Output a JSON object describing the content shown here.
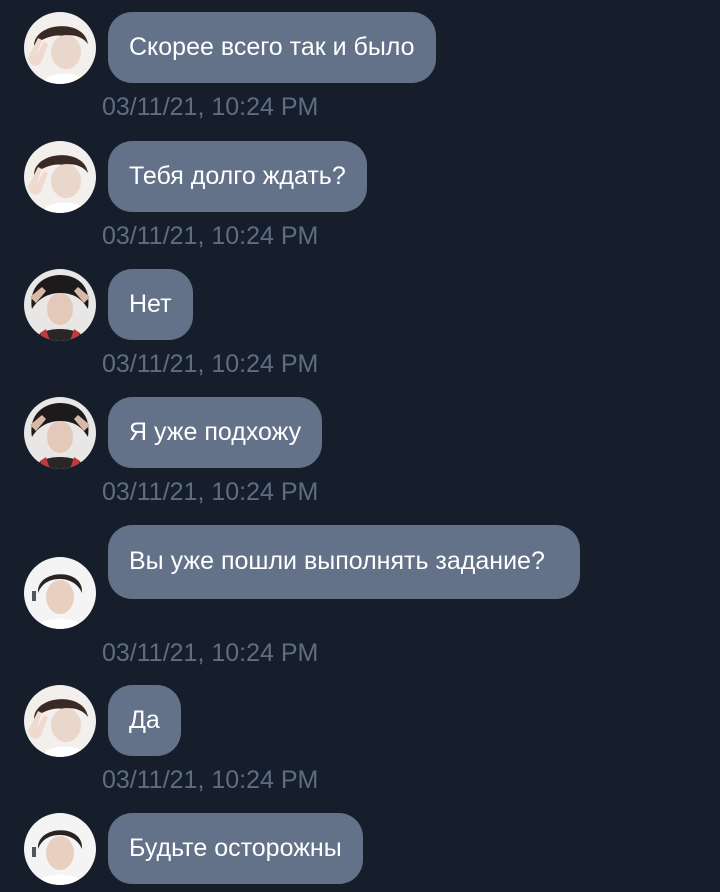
{
  "messages": [
    {
      "avatar": "avatar-hand-sign",
      "text": "Скорее всего так и было",
      "time": "03/11/21, 10:24 PM"
    },
    {
      "avatar": "avatar-hand-sign",
      "text": "Тебя долго ждать?",
      "time": "03/11/21, 10:24 PM"
    },
    {
      "avatar": "avatar-hands-on-head",
      "text": "Нет",
      "time": "03/11/21, 10:24 PM"
    },
    {
      "avatar": "avatar-hands-on-head",
      "text": "Я уже подхожу",
      "time": "03/11/21, 10:24 PM"
    },
    {
      "avatar": "avatar-portrait",
      "text": "Вы уже пошли выполнять задание?",
      "time": "03/11/21, 10:24 PM"
    },
    {
      "avatar": "avatar-hand-sign",
      "text": "Да",
      "time": "03/11/21, 10:24 PM"
    },
    {
      "avatar": "avatar-portrait",
      "text": "Будьте осторожны"
    }
  ],
  "colors": {
    "background": "#161e2c",
    "bubble": "#637289",
    "bubble_text": "#ffffff",
    "timestamp": "#5e6d82"
  }
}
